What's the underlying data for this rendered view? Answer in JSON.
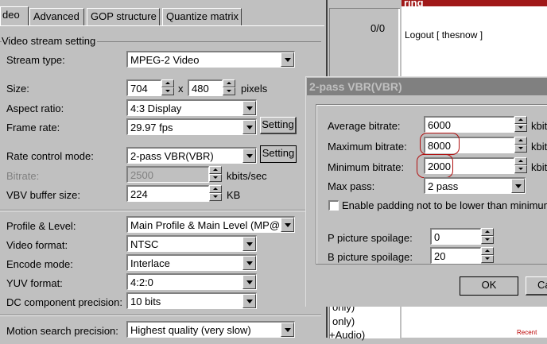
{
  "tabs": [
    "deo",
    "Advanced",
    "GOP structure",
    "Quantize matrix"
  ],
  "group_title": "Video stream setting",
  "stream_type": {
    "label": "Stream type:",
    "value": "MPEG-2 Video"
  },
  "size": {
    "label": "Size:",
    "width": "704",
    "x": "x",
    "height": "480",
    "unit": "pixels"
  },
  "aspect": {
    "label": "Aspect ratio:",
    "value": "4:3 Display"
  },
  "frame_rate": {
    "label": "Frame rate:",
    "value": "29.97 fps",
    "setting": "Setting"
  },
  "rate_control": {
    "label": "Rate control mode:",
    "value": "2-pass VBR(VBR)",
    "setting": "Setting"
  },
  "bitrate": {
    "label": "Bitrate:",
    "value": "2500",
    "unit": "kbits/sec"
  },
  "vbv": {
    "label": "VBV buffer size:",
    "value": "224",
    "unit": "KB"
  },
  "profile": {
    "label": "Profile & Level:",
    "value": "Main Profile & Main Level (MP@"
  },
  "video_format": {
    "label": "Video format:",
    "value": "NTSC"
  },
  "encode_mode": {
    "label": "Encode mode:",
    "value": "Interlace"
  },
  "yuv": {
    "label": "YUV format:",
    "value": "4:2:0"
  },
  "dc": {
    "label": "DC component precision:",
    "value": "10 bits"
  },
  "motion": {
    "label": "Motion search precision:",
    "value": "Highest quality (very slow)"
  },
  "middle_panel": {
    "counter": "0/0",
    "items": [
      "only)",
      "only)",
      "+Audio)"
    ]
  },
  "browser": {
    "title": "ring",
    "logout": "Logout [ thesnow ]",
    "footer": "Recent"
  },
  "dialog": {
    "title": "2-pass VBR(VBR)",
    "avg": {
      "label": "Average bitrate:",
      "value": "6000",
      "unit": "kbits"
    },
    "max": {
      "label": "Maximum bitrate:",
      "value": "8000",
      "unit": "kbits"
    },
    "min": {
      "label": "Minimum bitrate:",
      "value": "2000",
      "unit": "kbits"
    },
    "maxpass": {
      "label": "Max pass:",
      "value": "2 pass"
    },
    "padding": {
      "label": "Enable padding not to be lower than minimum"
    },
    "p_spoil": {
      "label": "P picture spoilage:",
      "value": "0"
    },
    "b_spoil": {
      "label": "B picture spoilage:",
      "value": "20"
    },
    "ok": "OK",
    "cancel": "Ca"
  },
  "colors": {
    "browser_title": "#8b1a1a",
    "circle": "#b01010"
  }
}
